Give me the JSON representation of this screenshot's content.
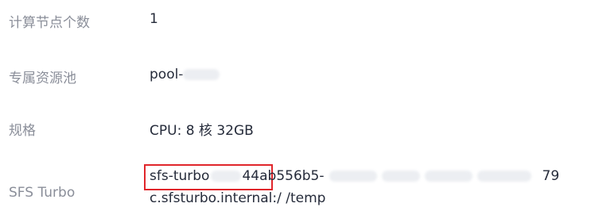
{
  "details": {
    "compute_nodes": {
      "label": "计算节点个数",
      "value": "1"
    },
    "dedicated_pool": {
      "label": "专属资源池",
      "value_prefix": "pool-"
    },
    "spec": {
      "label": "规格",
      "value": "CPU: 8 核 32GB"
    },
    "sfs_turbo": {
      "label": "SFS Turbo",
      "value_part1": "sfs-turbo",
      "value_part2": "4",
      "value_part3": "4ab556b5-",
      "value_part4": "79",
      "value_line2": "c.sfsturbo.internal:/ /temp"
    }
  },
  "colors": {
    "label_text": "#8a8e99",
    "value_text": "#252b3a",
    "highlight_border": "#e0262b",
    "redaction_blur": "#eceef2"
  }
}
